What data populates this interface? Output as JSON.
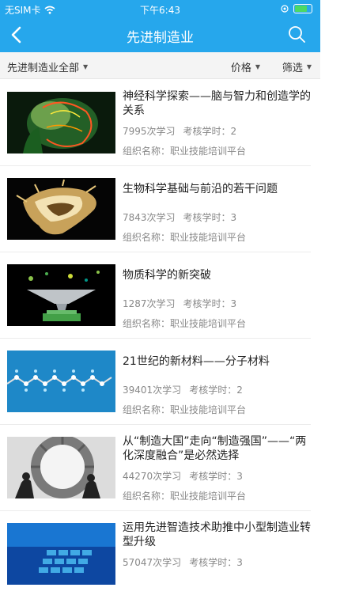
{
  "status": {
    "carrier": "无SIM卡",
    "time": "下午6:43"
  },
  "nav": {
    "title": "先进制造业"
  },
  "filters": {
    "category": "先进制造业全部",
    "price": "价格",
    "screen": "筛选"
  },
  "courses": [
    {
      "title": "神经科学探索——脑与智力和创造学的关系",
      "learners": "7995次学习",
      "hours": "考核学时：2",
      "org": "组织名称：职业技能培训平台"
    },
    {
      "title": "生物科学基础与前沿的若干问题",
      "learners": "7843次学习",
      "hours": "考核学时：3",
      "org": "组织名称：职业技能培训平台"
    },
    {
      "title": "物质科学的新突破",
      "learners": "1287次学习",
      "hours": "考核学时：3",
      "org": "组织名称：职业技能培训平台"
    },
    {
      "title": "21世纪的新材料——分子材料",
      "learners": "39401次学习",
      "hours": "考核学时：2",
      "org": "组织名称：职业技能培训平台"
    },
    {
      "title": "从“制造大国”走向“制造强国”——“两化深度融合”是必然选择",
      "learners": "44270次学习",
      "hours": "考核学时：3",
      "org": "组织名称：职业技能培训平台"
    },
    {
      "title": "运用先进智造技术助推中小型制造业转型升级",
      "learners": "57047次学习",
      "hours": "考核学时：3",
      "org": ""
    }
  ],
  "colors": {
    "header": "#26a7ec",
    "battery": "#4cd964"
  },
  "icons": {
    "back": "chevron-left-icon",
    "search": "search-icon",
    "wifi": "wifi-icon",
    "battery": "battery-icon"
  },
  "battery_level": 0.75
}
